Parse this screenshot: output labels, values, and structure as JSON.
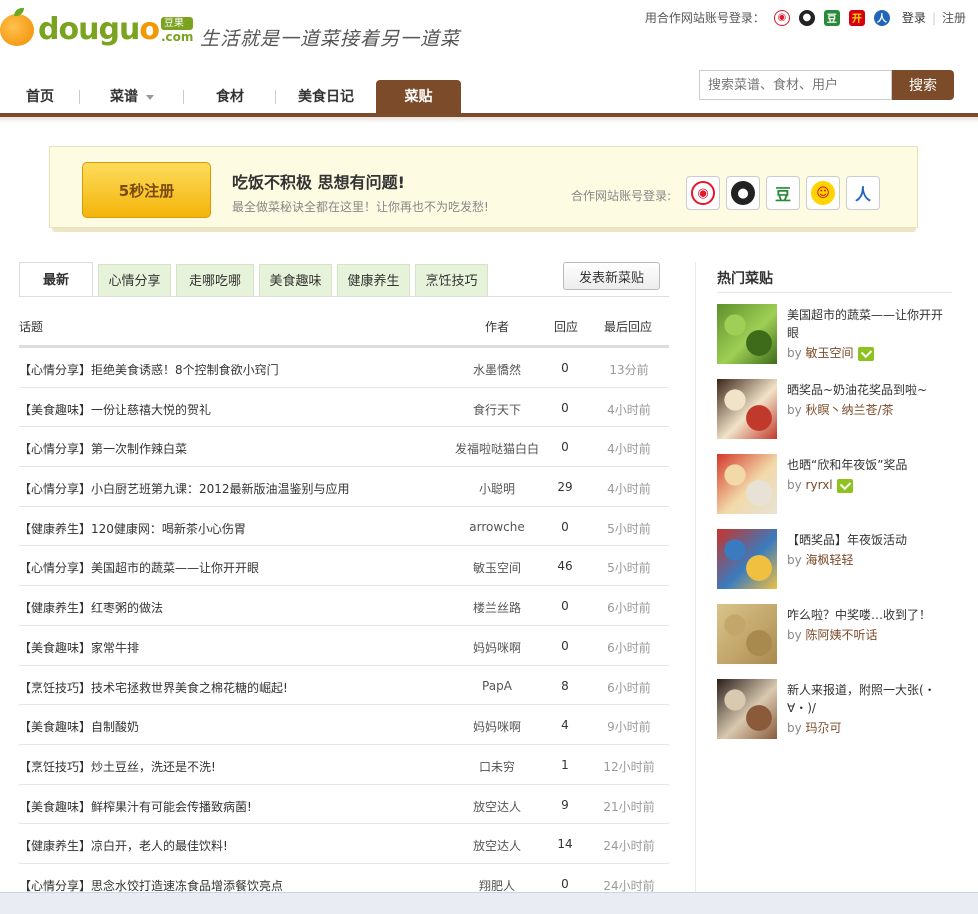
{
  "logo": {
    "brand": "douguo",
    "badge": "豆果",
    "domain": ".com"
  },
  "slogan": "生活就是一道菜接着另一道菜",
  "partner_login_top": {
    "label": "用合作网站账号登录：",
    "icons": [
      "weibo-icon",
      "qq-icon",
      "douban-icon",
      "kaixin-icon",
      "renren-icon"
    ],
    "douban_glyph": "豆",
    "kaixin_glyph": "开",
    "renren_glyph": "人",
    "login": "登录",
    "register": "注册"
  },
  "nav": {
    "items": [
      {
        "label": "首页"
      },
      {
        "label": "菜谱"
      },
      {
        "label": "食材"
      },
      {
        "label": "美食日记"
      },
      {
        "label": "菜贴"
      }
    ],
    "active_index": 4
  },
  "search": {
    "placeholder": "搜索菜谱、食材、用户",
    "button": "搜索"
  },
  "banner": {
    "register_button": "5秒注册",
    "title": "吃饭不积极 思想有问题!",
    "subtitle": "最全做菜秘诀全都在这里！让你再也不为吃发愁!",
    "partner_label": "合作网站账号登录:",
    "icons": [
      "weibo-icon",
      "qq-icon",
      "douban-icon",
      "kaixin-icon",
      "renren-icon"
    ],
    "douban_glyph": "豆",
    "renren_glyph": "人"
  },
  "tabs": [
    "最新",
    "心情分享",
    "走哪吃哪",
    "美食趣味",
    "健康养生",
    "烹饪技巧"
  ],
  "post_button": "发表新菜贴",
  "table": {
    "headers": {
      "topic": "话题",
      "author": "作者",
      "replies": "回应",
      "last": "最后回应"
    },
    "rows": [
      {
        "title": "【心情分享】拒绝美食诱惑！8个控制食欲小窍门",
        "author": "水墨憍然",
        "replies": "0",
        "time": "13分前"
      },
      {
        "title": "【美食趣味】一份让慈禧大悦的贺礼",
        "author": "食行天下",
        "replies": "0",
        "time": "4小时前"
      },
      {
        "title": "【心情分享】第一次制作辣白菜",
        "author": "发福啦哒猫白白",
        "replies": "0",
        "time": "4小时前"
      },
      {
        "title": "【心情分享】小白厨艺班第九课：2012最新版油温鉴别与应用",
        "author": "小聪明",
        "replies": "29",
        "time": "4小时前"
      },
      {
        "title": "【健康养生】120健康网：喝新茶小心伤胃",
        "author": "arrowche",
        "replies": "0",
        "time": "5小时前"
      },
      {
        "title": "【心情分享】美国超市的蔬菜——让你开开眼",
        "author": "敏玉空间",
        "replies": "46",
        "time": "5小时前"
      },
      {
        "title": "【健康养生】红枣粥的做法",
        "author": "楼兰丝路",
        "replies": "0",
        "time": "6小时前"
      },
      {
        "title": "【美食趣味】家常牛排",
        "author": "妈妈咪啊",
        "replies": "0",
        "time": "6小时前"
      },
      {
        "title": "【烹饪技巧】技术宅拯救世界美食之棉花糖的崛起!",
        "author": "PapA",
        "replies": "8",
        "time": "6小时前"
      },
      {
        "title": "【美食趣味】自制酸奶",
        "author": "妈妈咪啊",
        "replies": "4",
        "time": "9小时前"
      },
      {
        "title": "【烹饪技巧】炒土豆丝，洗还是不洗!",
        "author": "口未穷",
        "replies": "1",
        "time": "12小时前"
      },
      {
        "title": "【美食趣味】鲜榨果汁有可能会传播致病菌!",
        "author": "放空达人",
        "replies": "9",
        "time": "21小时前"
      },
      {
        "title": "【健康养生】凉白开，老人的最佳饮料!",
        "author": "放空达人",
        "replies": "14",
        "time": "24小时前"
      },
      {
        "title": "【心情分享】思念水饺打造速冻食品增添餐饮亮点",
        "author": "翔肥人",
        "replies": "0",
        "time": "24小时前"
      }
    ]
  },
  "sidebar": {
    "title": "热门菜贴",
    "by_prefix": "by",
    "items": [
      {
        "title": "美国超市的蔬菜——让你开开眼",
        "author": "敏玉空间",
        "verified": true,
        "colors": [
          "#5e8f2c",
          "#9fcf55",
          "#3d6b1a"
        ]
      },
      {
        "title": "晒奖品~奶油花奖品到啦~",
        "author": "秋瞑丶纳兰苍/茶",
        "verified": false,
        "colors": [
          "#3a2418",
          "#f1e3c8",
          "#c0392b"
        ]
      },
      {
        "title": "也晒“欣和年夜饭”奖品",
        "author": "ryrxl",
        "verified": true,
        "colors": [
          "#d4382c",
          "#f2d9a8",
          "#e8e2d6"
        ]
      },
      {
        "title": "【晒奖品】年夜饭活动",
        "author": "海枫轻轻",
        "verified": false,
        "colors": [
          "#c9332a",
          "#3a7bbf",
          "#f0c040"
        ]
      },
      {
        "title": "咋么啦？中奖喽…收到了！",
        "author": "陈阿姨不听话",
        "verified": false,
        "colors": [
          "#d9c38a",
          "#c2a66a",
          "#a8894e"
        ]
      },
      {
        "title": "新人来报道，附照一大张(・∀・)/",
        "author": "玛尕可",
        "verified": false,
        "colors": [
          "#2a1e1a",
          "#d9c9b0",
          "#8a5a3a"
        ]
      }
    ]
  }
}
